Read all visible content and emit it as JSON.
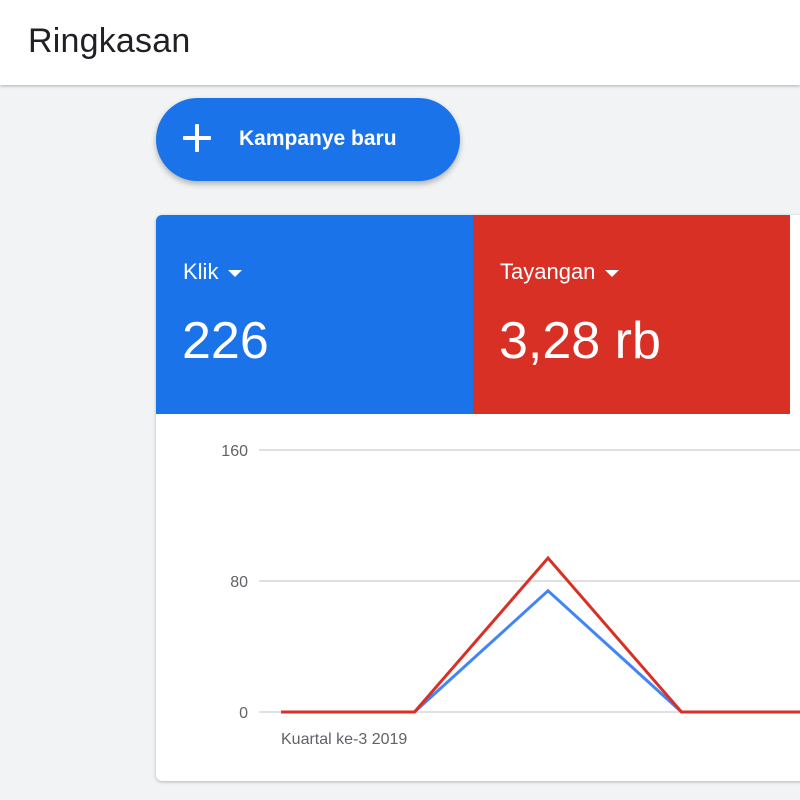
{
  "header": {
    "title": "Ringkasan"
  },
  "new_campaign_button": {
    "label": "Kampanye baru",
    "icon": "plus-icon"
  },
  "metrics": [
    {
      "name": "Klik",
      "value": "226",
      "color": "#1a73e8"
    },
    {
      "name": "Tayangan",
      "value": "3,28 rb",
      "color": "#d93025"
    }
  ],
  "chart_data": {
    "type": "line",
    "x_label_shown": "Kuartal ke-3 2019",
    "yticks": [
      "160",
      "80",
      "0"
    ],
    "ylim": [
      0,
      160
    ],
    "grid": true,
    "series": [
      {
        "name": "Klik",
        "color": "#4285f4",
        "values": [
          0,
          0,
          74,
          0,
          0
        ]
      },
      {
        "name": "Tayangan",
        "color": "#d93025",
        "values": [
          0,
          0,
          94,
          0,
          0
        ]
      }
    ]
  }
}
